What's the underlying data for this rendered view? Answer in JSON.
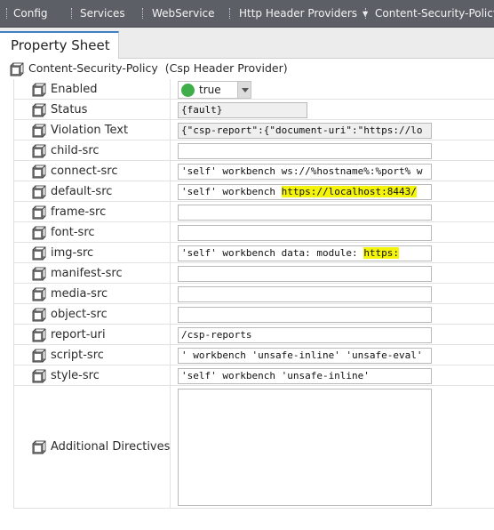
{
  "breadcrumb": [
    {
      "label": "Config"
    },
    {
      "label": "Services"
    },
    {
      "label": "WebService"
    },
    {
      "label": "Http Header Providers",
      "has_menu": true
    },
    {
      "label": "Content-Security-Policy"
    }
  ],
  "tab": {
    "label": "Property Sheet"
  },
  "root": {
    "name": "Content-Security-Policy",
    "type": "(Csp Header Provider)"
  },
  "properties": {
    "enabled": {
      "label": "Enabled",
      "value": "true",
      "status_color": "#3fae4a"
    },
    "status": {
      "label": "Status",
      "value": "{fault}"
    },
    "violation_text": {
      "label": "Violation Text",
      "value": "{\"csp-report\":{\"document-uri\":\"https://lo"
    },
    "child_src": {
      "label": "child-src",
      "value": ""
    },
    "connect_src": {
      "label": "connect-src",
      "value": "'self' workbench ws://%hostname%:%port% w"
    },
    "default_src": {
      "label": "default-src",
      "value_plain": "'self' workbench ",
      "value_highlight": "https://localhost:8443/"
    },
    "frame_src": {
      "label": "frame-src",
      "value": ""
    },
    "font_src": {
      "label": "font-src",
      "value": ""
    },
    "img_src": {
      "label": "img-src",
      "value_plain": "'self' workbench data: module: ",
      "value_highlight": "https:"
    },
    "manifest_src": {
      "label": "manifest-src",
      "value": ""
    },
    "media_src": {
      "label": "media-src",
      "value": ""
    },
    "object_src": {
      "label": "object-src",
      "value": ""
    },
    "report_uri": {
      "label": "report-uri",
      "value": "/csp-reports"
    },
    "script_src": {
      "label": "script-src",
      "value": "' workbench 'unsafe-inline' 'unsafe-eval'"
    },
    "style_src": {
      "label": "style-src",
      "value": "'self' workbench 'unsafe-inline'"
    },
    "additional_directives": {
      "label": "Additional Directives",
      "value": ""
    }
  },
  "colors": {
    "breadcrumb_bg": "#5c6066",
    "tab_accent": "#3f7fc2",
    "highlight": "#f4f40a"
  }
}
